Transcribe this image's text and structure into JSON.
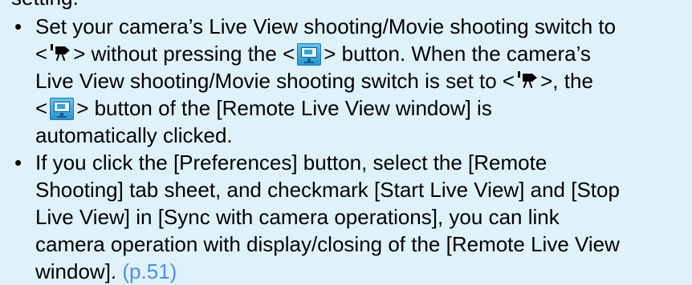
{
  "top_fragment": "setting.",
  "bullets": [
    {
      "b1_line1": "Set your camera’s Live View shooting/Movie shooting switch to",
      "b1_line2_a": "<",
      "b1_line2_b": "> without pressing the <",
      "b1_line2_c": "> button. When the camera’s",
      "b1_line3_a": "Live View shooting/Movie shooting switch is set to <",
      "b1_line3_b": ">, the",
      "b1_line4_a": "<",
      "b1_line4_b": "> button of the [Remote Live View window] is",
      "b1_line5": "automatically clicked."
    },
    {
      "b2_line1": "If you click the [Preferences] button, select the [Remote",
      "b2_line2": "Shooting] tab sheet, and checkmark [Start Live View] and [Stop",
      "b2_line3": "Live View] in [Sync with camera operations], you can link",
      "b2_line4": "camera operation with display/closing of the [Remote Live View",
      "b2_line5": "window].",
      "b2_link": "(p.51)"
    }
  ],
  "bullet_char": "•",
  "icons": {
    "movie_mode": "movie-shooting-icon",
    "remote_live_view": "remote-live-view-button-icon"
  },
  "colors": {
    "background": "#dff2fa",
    "link": "#4a90e2",
    "icon_blue": "#2a95d0"
  }
}
